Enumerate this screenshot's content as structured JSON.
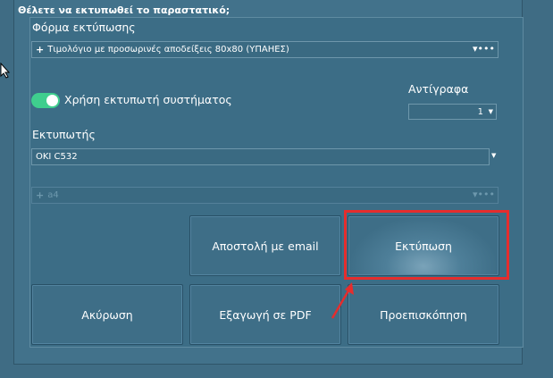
{
  "dialog": {
    "title": "Θέλετε να  εκτυπωθεί το παραστατικό;"
  },
  "print_form": {
    "label": "Φόρμα εκτύπωσης",
    "value": "Τιμολόγιο με προσωρινές αποδείξεις 80x80 (ΥΠΑΗΕΣ)"
  },
  "system_printer_toggle": {
    "label": "Χρήση εκτυπωτή συστήματος",
    "on": true,
    "color": "#3fce8e"
  },
  "copies": {
    "label": "Αντίγραφα",
    "value": "1"
  },
  "printer": {
    "label": "Εκτυπωτής",
    "value": "OKI C532"
  },
  "paper": {
    "value": "a4",
    "enabled": false
  },
  "buttons": {
    "send_email": "Αποστολή με email",
    "print": "Εκτύπωση",
    "cancel": "Ακύρωση",
    "export_pdf": "Εξαγωγή σε PDF",
    "preview": "Προεπισκόπηση"
  },
  "annotation": {
    "highlight_color": "#e52d2d"
  }
}
